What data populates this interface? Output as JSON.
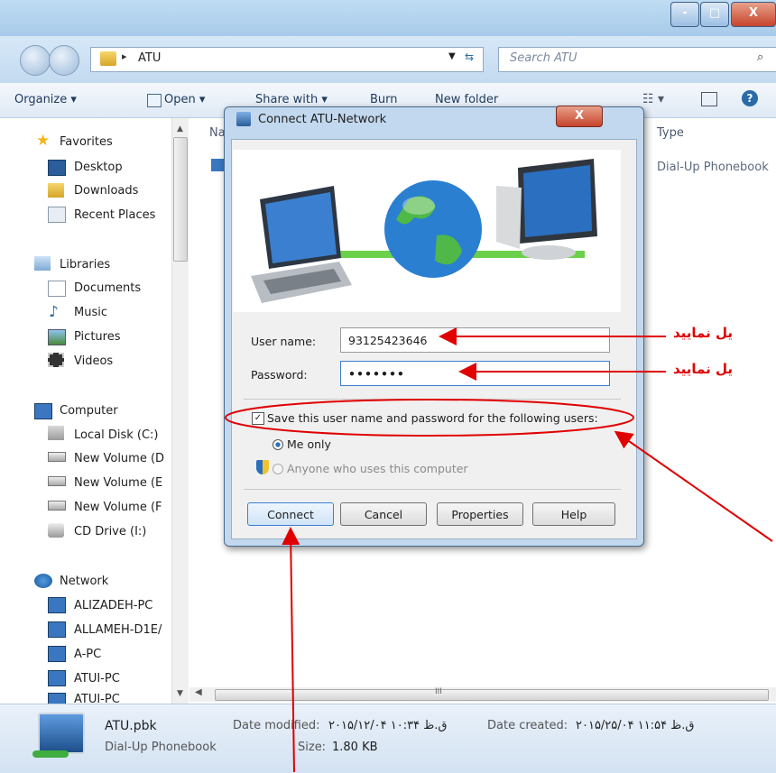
{
  "window": {
    "title": "",
    "controls": [
      "-",
      "□",
      "X"
    ]
  },
  "navigation": {
    "address": "ATU",
    "search_placeholder": "Search ATU"
  },
  "toolbar": {
    "organize": "Organize ▾",
    "open": "Open ▾",
    "share_with": "Share with ▾",
    "burn": "Burn",
    "new_folder": "New folder"
  },
  "file_list": {
    "columns": [
      "Na",
      "Type"
    ],
    "rows": [
      {
        "type": "Dial-Up Phonebook"
      }
    ]
  },
  "sidebar": {
    "favorites": "Favorites",
    "desktop": "Desktop",
    "downloads": "Downloads",
    "recent_places": "Recent Places",
    "libraries": "Libraries",
    "documents": "Documents",
    "music": "Music",
    "pictures": "Pictures",
    "videos": "Videos",
    "computer": "Computer",
    "local_disk": "Local Disk (C:)",
    "new_volume_d": "New Volume (D",
    "new_volume_e": "New Volume (E",
    "new_volume_f": "New Volume (F",
    "cd_drive": "CD Drive (I:)",
    "network": "Network",
    "alizadeh": "ALIZADEH-PC",
    "allameh": "ALLAMEH-D1E/",
    "apc": "A-PC",
    "atuipc": "ATUI-PC",
    "atuipc2": "ATUI-PC"
  },
  "dialog": {
    "title": "Connect ATU-Network",
    "close": "X",
    "username_label": "User name:",
    "username_value": "93125423646",
    "password_label": "Password:",
    "password_value": "•••••••",
    "save_checkbox": "Save this user name and password for the following users:",
    "me_only": "Me only",
    "anyone": "Anyone who uses this computer",
    "connect": "Connect",
    "cancel": "Cancel",
    "properties": "Properties",
    "help": "Help"
  },
  "annotations": {
    "arrow1_text": "یل نمایید",
    "arrow2_text": "یل نمایید"
  },
  "details": {
    "filename": "ATU.pbk",
    "filetype": "Dial-Up Phonebook",
    "date_modified_label": "Date modified:",
    "date_modified": "۲۰۱۵/۱۲/۰۴ ق.ظ ۱۰:۳۴",
    "date_created_label": "Date created:",
    "date_created": "۲۰۱۵/۲۵/۰۴ ق.ظ ۱۱:۵۴",
    "size_label": "Size:",
    "size": "1.80 KB",
    "ellipsis": "III"
  },
  "colors": {
    "accent": "#e00000",
    "chrome": "#c3daf0"
  }
}
